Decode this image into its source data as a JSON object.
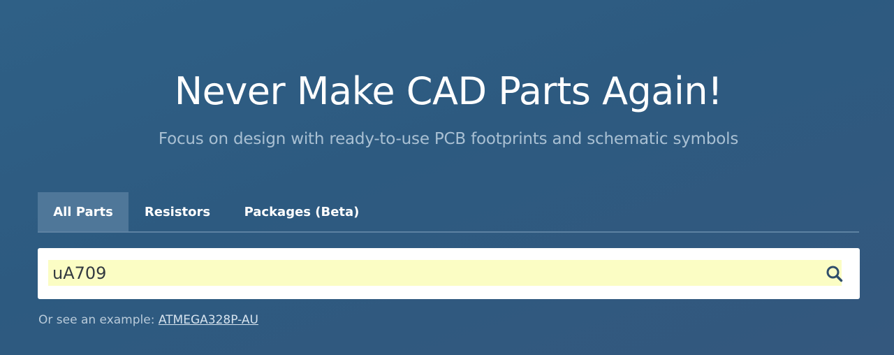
{
  "hero": {
    "title": "Never Make CAD Parts Again!",
    "subtitle": "Focus on design with ready-to-use PCB footprints and schematic symbols"
  },
  "tabs": [
    {
      "label": "All Parts",
      "active": true
    },
    {
      "label": "Resistors",
      "active": false
    },
    {
      "label": "Packages (Beta)",
      "active": false
    }
  ],
  "search": {
    "value": "uA709",
    "icon": "search-icon"
  },
  "example": {
    "prefix": "Or see an example: ",
    "link": "ATMEGA328P-AU"
  },
  "colors": {
    "background": "#2f6086",
    "active_tab": "#4f7799",
    "input_highlight": "#fbfdc4",
    "search_icon": "#2f4e6b"
  }
}
